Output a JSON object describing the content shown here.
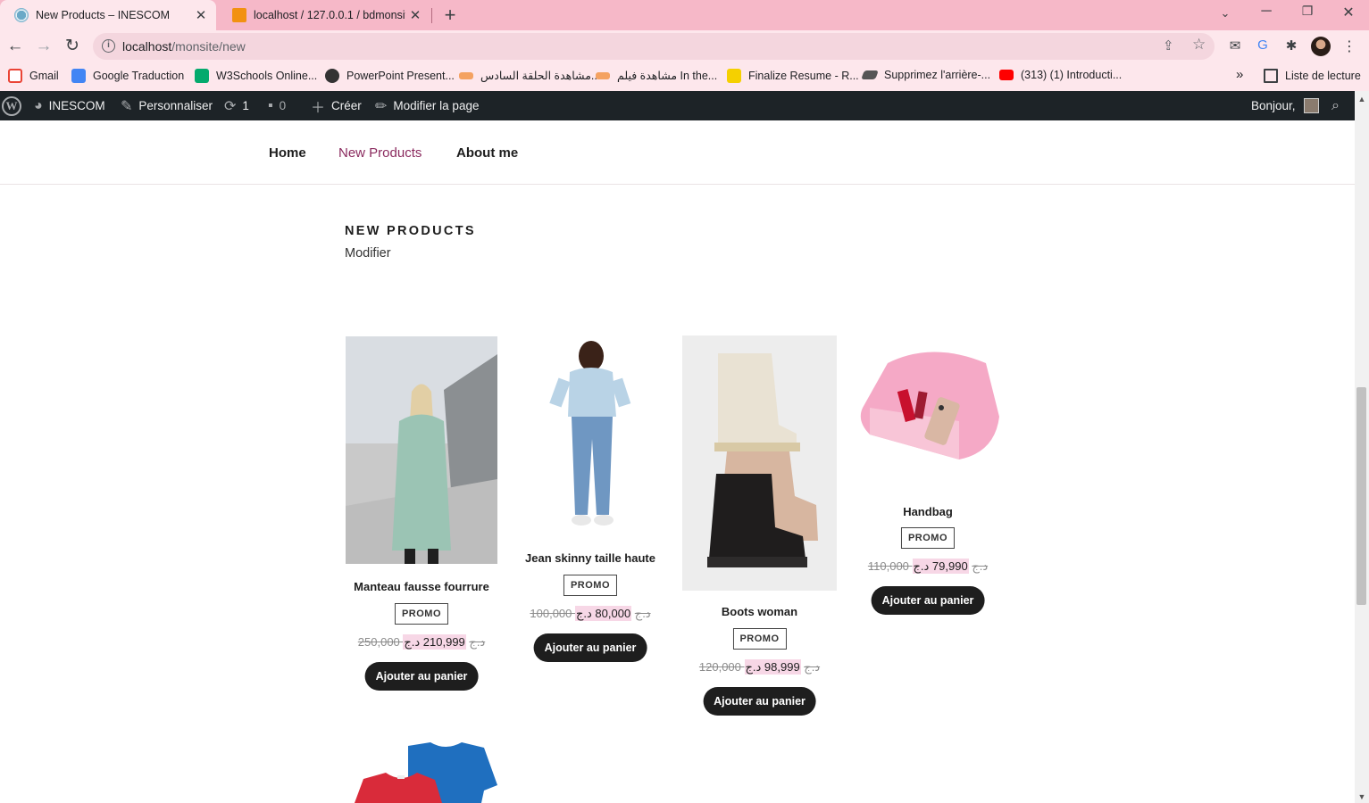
{
  "browser": {
    "tabs": [
      {
        "title": "New Products – INESCOM",
        "active": true
      },
      {
        "title": "localhost / 127.0.0.1 / bdmonsite",
        "active": false
      }
    ],
    "url_host": "localhost",
    "url_path": "/monsite/new",
    "bookmarks": [
      {
        "label": "Gmail",
        "icon": "gmail-icon",
        "color": "#ea4335"
      },
      {
        "label": "Google Traduction",
        "icon": "google-translate-icon",
        "color": "#4285f4"
      },
      {
        "label": "W3Schools Online...",
        "icon": "w3schools-icon",
        "color": "#04aa6d"
      },
      {
        "label": "PowerPoint Present...",
        "icon": "globe-icon",
        "color": "#333333"
      },
      {
        "label": "مشاهدة الحلقة السادس...",
        "icon": "site-icon",
        "color": "#f4a261"
      },
      {
        "label": "مشاهدة فيلم In the...",
        "icon": "site-icon",
        "color": "#f4a261"
      },
      {
        "label": "Finalize Resume - R...",
        "icon": "resume-icon",
        "color": "#f5d000"
      },
      {
        "label": "Supprimez l'arrière-...",
        "icon": "remove-bg-icon",
        "color": "#555555"
      },
      {
        "label": "(313) (1) Introducti...",
        "icon": "youtube-icon",
        "color": "#ff0000"
      }
    ],
    "overflow": "»",
    "reading_list": "Liste de lecture"
  },
  "adminbar": {
    "site": "INESCOM",
    "customize": "Personnaliser",
    "updates": "1",
    "comments": "0",
    "new": "Créer",
    "edit": "Modifier la page",
    "greeting": "Bonjour,"
  },
  "nav": {
    "items": [
      "Home",
      "New Products",
      "About me"
    ],
    "current": "New Products"
  },
  "page": {
    "title": "NEW PRODUCTS",
    "edit_link": "Modifier"
  },
  "products": [
    {
      "name": "Manteau fausse fourrure",
      "badge": "PROMO",
      "old_price": "250,000 د.ج",
      "new_price": "210,999 د.ج",
      "button": "Ajouter au panier"
    },
    {
      "name": "Jean skinny taille haute",
      "badge": "PROMO",
      "old_price": "100,000 د.ج",
      "new_price": "80,000 د.ج",
      "button": "Ajouter au panier"
    },
    {
      "name": "Boots woman",
      "badge": "PROMO",
      "old_price": "120,000 د.ج",
      "new_price": "98,999 د.ج",
      "button": "Ajouter au panier"
    },
    {
      "name": "Handbag",
      "badge": "PROMO",
      "old_price": "110,000 د.ج",
      "new_price": "79,990 د.ج",
      "button": "Ajouter au panier"
    }
  ],
  "colors": {
    "chrome_pink": "#f6b8c8",
    "adminbar": "#1d2327",
    "nav_current": "#8a2a5e",
    "price_highlight": "#f7d7e6",
    "button": "#1e1e1e"
  }
}
